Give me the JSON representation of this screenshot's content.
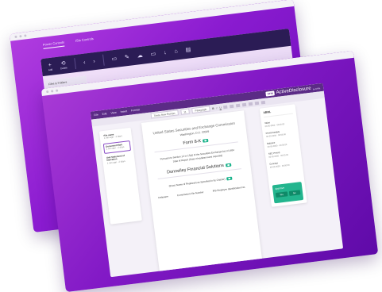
{
  "back_window": {
    "tabs": [
      "Power Controls",
      "ISIs Controls"
    ],
    "toolbar_items": [
      "Add",
      "Delete",
      "Back",
      "Forward",
      "Edit page",
      "Edit",
      "Cloud",
      "Monitor",
      "Download",
      "Lock",
      "Print"
    ],
    "sidebar_header": "Files & Folders"
  },
  "app": {
    "menu": [
      "File",
      "Edit",
      "View",
      "Insert",
      "Format"
    ],
    "logo_mark": "DFIN",
    "logo_name": "ActiveDisclosure",
    "logo_by": "by DFIN",
    "toolbar_font": "Times New Roman",
    "toolbar_size": "11",
    "toolbar_style": "Paragraph",
    "files": [
      {
        "title": "File name",
        "meta": "1 min ago · 2 days"
      },
      {
        "title": "Document Mark",
        "meta": "1 min ago · 2 days"
      },
      {
        "title": "Unit Statement of Operation",
        "meta": "1 min ago · 2 days"
      }
    ],
    "document": {
      "line1": "United States Securities and Exchange Commission",
      "line2": "Washington, D.C. 20549",
      "form": "Form 8-K",
      "line4": "Pursuant to Section 13 or 15(d) of the Securities Exchange Act of 1934",
      "line5": "Date of Report (Date of earliest event reported)",
      "company": "Donnelley Financial Solutions",
      "line7": "(Exact Name of Registrant as Specified in Its Charter)",
      "footer": [
        "Delaware",
        "Commission File Number",
        "IRS Employer Identification No."
      ]
    },
    "xbrl": {
      "title": "XBRL",
      "items": [
        {
          "key": "Value",
          "val": "00-00-0000 · 00:00:00"
        },
        {
          "key": "Period Details",
          "val": "00-00-0000 · 00:00:00"
        },
        {
          "key": "Balance",
          "val": "00-00-0000 · 00:00:00"
        },
        {
          "key": "SEC Period",
          "val": "00-00-0000 · 00:00:00"
        },
        {
          "key": "Concept",
          "val": "00-00-0000 · 00:00:00"
        }
      ]
    },
    "approve": {
      "label": "Approve",
      "yes": "Yes",
      "no": "No",
      "color": "#23b58e"
    }
  }
}
